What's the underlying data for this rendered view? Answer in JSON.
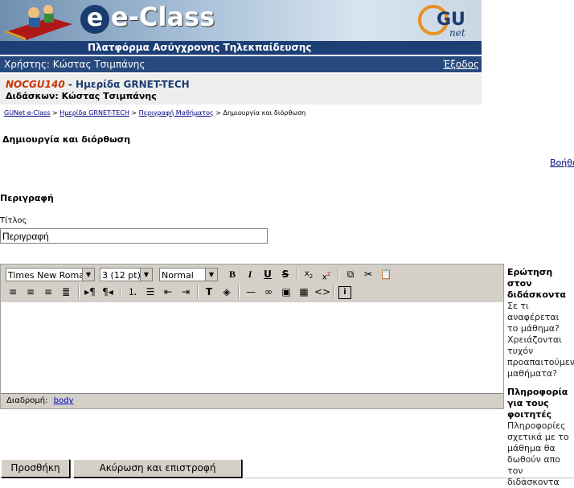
{
  "header": {
    "logo_text": "e-Class",
    "subtitle": "Πλατφόρμα Ασύγχρονης Τηλεκπαίδευσης",
    "partner_logo": "GUnet"
  },
  "userbar": {
    "user": "Χρήστης: Κώστας Τσιμπάνης",
    "logout": "Έξοδος"
  },
  "course": {
    "code": "NOCGU140",
    "name": " - Ημερίδα GRNET-TECH",
    "instructors": "Διδάσκων: Κώστας Τσιμπάνης"
  },
  "breadcrumb": {
    "items": [
      "GUNet e-Class",
      "Ημερίδα GRNET-TECH",
      "Περιγραφή Μαθήματος"
    ],
    "separator": " > ",
    "current": "Δημιουργία και διόρθωση"
  },
  "page": {
    "title": "Δημιουργία και διόρθωση",
    "help_link": "Βοήθεια",
    "section_heading": "Περιγραφή",
    "field_label": "Τίτλος",
    "field_value": "Περιγραφή"
  },
  "editor": {
    "font_family": "Times New Roman",
    "font_size": "3 (12 pt)",
    "format": "Normal",
    "path_label": "Διαδρομή:",
    "path_link": "body",
    "content": ""
  },
  "sidebar": {
    "q1_title": [
      "Ερώτηση στον",
      "διδάσκοντα"
    ],
    "q1_text": [
      "Σε τι αναφέρεται",
      "το μάθημα?",
      "Χρειάζονται",
      "τυχόν",
      "προαπαιτούμενα",
      "μαθήματα?"
    ],
    "q2_title": [
      "Πληροφορία",
      "για τους",
      "φοιτητές"
    ],
    "q2_text": [
      "Πληροφορίες",
      "σχετικά με το",
      "μάθημα θα",
      "δωθούν απο τον",
      "διδάσκοντα"
    ]
  },
  "buttons": {
    "add": "Προσθήκη",
    "cancel": "Ακύρωση και επιστροφή"
  },
  "colors": {
    "header_dark": "#1d3f75",
    "course_code": "#cc3300",
    "link": "#000080"
  }
}
